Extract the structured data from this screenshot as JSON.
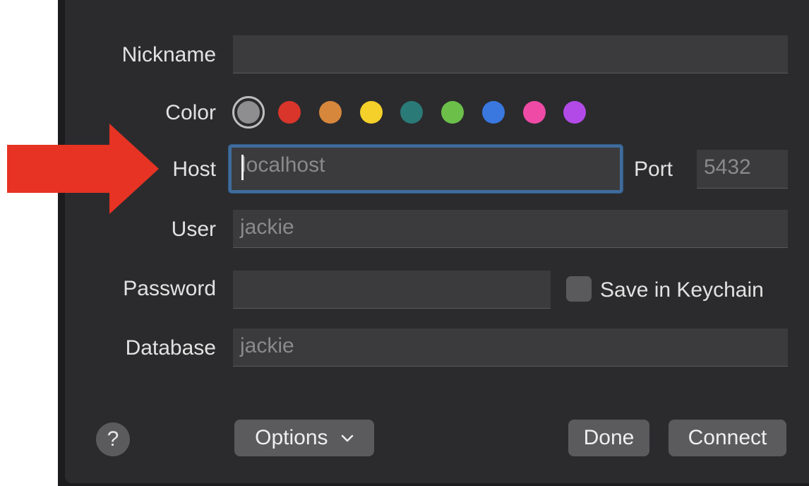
{
  "form": {
    "nickname_label": "Nickname",
    "nickname_value": "",
    "color_label": "Color",
    "colors": {
      "selected": "#8e8e90",
      "red": "#d9352b",
      "orange": "#d6873c",
      "yellow": "#f5d02a",
      "teal": "#2a7a78",
      "green": "#6cc04a",
      "blue": "#3a78e0",
      "pink": "#ee4aa6",
      "purple": "#b24ae8"
    },
    "host_label": "Host",
    "host_placeholder": "localhost",
    "port_label": "Port",
    "port_placeholder": "5432",
    "user_label": "User",
    "user_placeholder": "jackie",
    "password_label": "Password",
    "password_value": "",
    "save_keychain_label": "Save in Keychain",
    "save_keychain_checked": false,
    "database_label": "Database",
    "database_placeholder": "jackie"
  },
  "footer": {
    "help_label": "?",
    "options_label": "Options",
    "options_icon": "chevron-down-icon",
    "done_label": "Done",
    "connect_label": "Connect"
  },
  "annotation": {
    "arrow_color": "#e63323"
  }
}
